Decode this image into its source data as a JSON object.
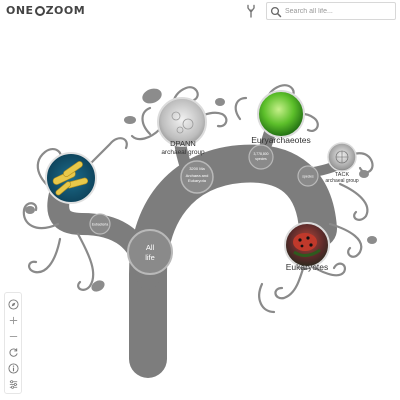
{
  "app": {
    "logo_left": "ONE",
    "logo_right": "ZOOM"
  },
  "search": {
    "placeholder": "Search all life..."
  },
  "tree": {
    "root": {
      "line1": "All",
      "line2": "life"
    },
    "node_archaea_eukarya": {
      "line1": "3200 Ma",
      "line2": "Archaea and",
      "line3": "Eukaryota"
    },
    "node_small_left": "Eubacteria",
    "node_euryarchaeotes_small": {
      "line1": "3,778,800",
      "line2": "species"
    },
    "node_tack_small": "species",
    "clades": [
      {
        "name": "DPANN",
        "line2": "archaeal group"
      },
      {
        "name": "Euryarchaeotes"
      },
      {
        "name": "TACK",
        "line2": "archaeal group"
      },
      {
        "name": "Eukaryotes"
      }
    ]
  },
  "controls": {
    "icons": [
      "compass-icon",
      "zoom-in-icon",
      "zoom-out-icon",
      "reset-icon",
      "info-icon",
      "settings-icon"
    ]
  }
}
